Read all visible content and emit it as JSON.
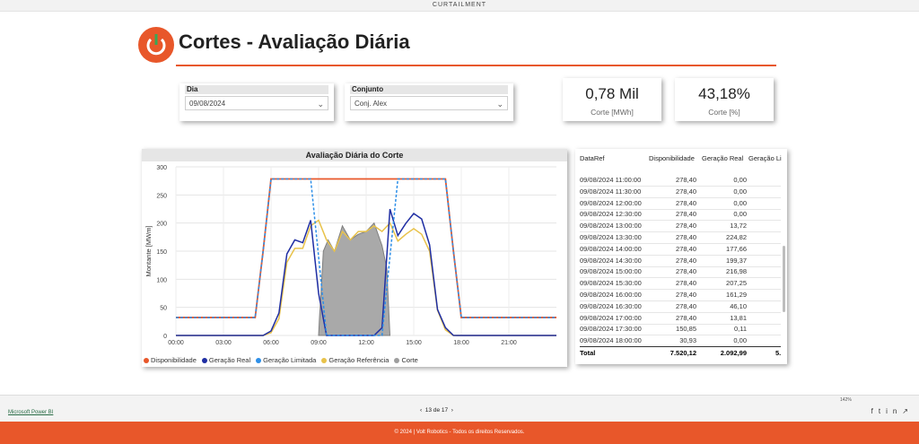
{
  "window": {
    "title": "CURTAILMENT"
  },
  "header": {
    "title": "Cortes - Avaliação Diária"
  },
  "filters": {
    "dia": {
      "label": "Dia",
      "value": "09/08/2024"
    },
    "conjunto": {
      "label": "Conjunto",
      "value": "Conj. Alex"
    }
  },
  "kpis": [
    {
      "value": "0,78 Mil",
      "label": "Corte [MWh]"
    },
    {
      "value": "43,18%",
      "label": "Corte [%]"
    }
  ],
  "chart_data": {
    "type": "line",
    "title": "Avaliação Diária do Corte",
    "ylabel": "Montante [MWm]",
    "xlabel": "",
    "ylim": [
      0,
      300
    ],
    "yticks": [
      0,
      50,
      100,
      150,
      200,
      250,
      300
    ],
    "xlim": [
      0,
      24
    ],
    "xticks": [
      "00:00",
      "03:00",
      "06:00",
      "09:00",
      "12:00",
      "15:00",
      "18:00",
      "21:00"
    ],
    "series": [
      {
        "name": "Disponibilidade",
        "color": "#e8572a",
        "x": [
          0,
          5.0,
          5.5,
          6.0,
          17.0,
          17.5,
          18.0,
          24
        ],
        "y": [
          32,
          32,
          150,
          278.4,
          278.4,
          150.85,
          32,
          32
        ]
      },
      {
        "name": "Geração Real",
        "color": "#1f2ea3",
        "x": [
          0,
          5.5,
          6,
          6.5,
          7,
          7.5,
          8,
          8.5,
          9,
          9.5,
          10,
          10.5,
          11,
          11.5,
          12,
          12.5,
          13,
          13.5,
          14,
          14.5,
          15,
          15.5,
          16,
          16.5,
          17,
          17.5,
          18,
          24
        ],
        "y": [
          0,
          0,
          8,
          40,
          145,
          170,
          165,
          205,
          75,
          0,
          0,
          0,
          0,
          0,
          0,
          0,
          13.72,
          224.82,
          177.66,
          199.37,
          216.98,
          207.25,
          161.29,
          46.1,
          13.81,
          0.11,
          0,
          0
        ]
      },
      {
        "name": "Geração Limitada",
        "color": "#2d8fe8",
        "x": [
          0,
          5.0,
          5.5,
          6.0,
          8.5,
          9.0,
          9.5,
          13.0,
          13.5,
          14,
          17.0,
          17.5,
          18.0,
          24
        ],
        "y": [
          32,
          32,
          150,
          278.4,
          278.4,
          140,
          0,
          0,
          140,
          278.4,
          278.4,
          150.85,
          32,
          32
        ]
      },
      {
        "name": "Geração Referência",
        "color": "#e8c24a",
        "x": [
          0,
          5.5,
          6,
          6.5,
          7,
          7.5,
          8,
          8.5,
          9,
          9.5,
          10,
          10.5,
          11,
          11.5,
          12,
          12.5,
          13,
          13.5,
          14,
          14.5,
          15,
          15.5,
          16,
          16.5,
          17,
          17.5,
          18,
          24
        ],
        "y": [
          0,
          0,
          5,
          30,
          130,
          155,
          155,
          195,
          205,
          170,
          150,
          185,
          170,
          185,
          185,
          195,
          185,
          200,
          168,
          180,
          190,
          180,
          150,
          45,
          10,
          0,
          0,
          0
        ]
      },
      {
        "name": "Corte",
        "color": "#9e9e9e",
        "x": [
          9.0,
          9.3,
          9.6,
          10,
          10.5,
          11,
          11.5,
          12,
          12.5,
          13,
          13.3,
          13.5
        ],
        "y": [
          0,
          150,
          170,
          150,
          195,
          170,
          180,
          185,
          200,
          160,
          120,
          0
        ]
      }
    ]
  },
  "table": {
    "columns": [
      "DataRef",
      "Disponibilidade",
      "Geração Real",
      "Geração Li"
    ],
    "rows": [
      [
        "09/08/2024 11:00:00",
        "278,40",
        "0,00"
      ],
      [
        "09/08/2024 11:30:00",
        "278,40",
        "0,00"
      ],
      [
        "09/08/2024 12:00:00",
        "278,40",
        "0,00"
      ],
      [
        "09/08/2024 12:30:00",
        "278,40",
        "0,00"
      ],
      [
        "09/08/2024 13:00:00",
        "278,40",
        "13,72"
      ],
      [
        "09/08/2024 13:30:00",
        "278,40",
        "224,82"
      ],
      [
        "09/08/2024 14:00:00",
        "278,40",
        "177,66"
      ],
      [
        "09/08/2024 14:30:00",
        "278,40",
        "199,37"
      ],
      [
        "09/08/2024 15:00:00",
        "278,40",
        "216,98"
      ],
      [
        "09/08/2024 15:30:00",
        "278,40",
        "207,25"
      ],
      [
        "09/08/2024 16:00:00",
        "278,40",
        "161,29"
      ],
      [
        "09/08/2024 16:30:00",
        "278,40",
        "46,10"
      ],
      [
        "09/08/2024 17:00:00",
        "278,40",
        "13,81"
      ],
      [
        "09/08/2024 17:30:00",
        "150,85",
        "0,11"
      ],
      [
        "09/08/2024 18:00:00",
        "30,93",
        "0,00"
      ]
    ],
    "total": {
      "label": "Total",
      "disponibilidade": "7.520,12",
      "geracao_real": "2.092,99",
      "geracao_li": "5."
    }
  },
  "bottombar": {
    "powerbi_link": "Microsoft Power BI",
    "pager": "13 de 17",
    "zoom": "142%"
  },
  "footer": {
    "text": "© 2024 | Volt Robotics - Todos os direitos Reservados."
  }
}
